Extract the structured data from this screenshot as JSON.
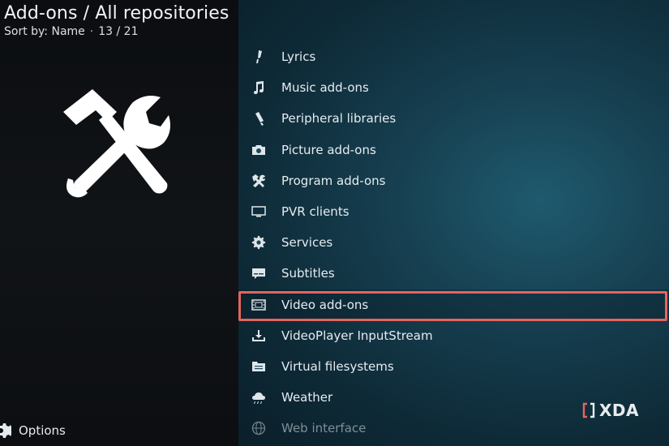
{
  "header": {
    "title": "Add-ons / All repositories",
    "sort_label": "Sort by: Name",
    "separator": "·",
    "position": "13 / 21"
  },
  "footer": {
    "options_label": "Options"
  },
  "categories": [
    {
      "label": "Lyrics",
      "icon": "microphone-icon"
    },
    {
      "label": "Music add-ons",
      "icon": "music-note-icon"
    },
    {
      "label": "Peripheral libraries",
      "icon": "usb-icon"
    },
    {
      "label": "Picture add-ons",
      "icon": "camera-icon"
    },
    {
      "label": "Program add-ons",
      "icon": "tools-icon"
    },
    {
      "label": "PVR clients",
      "icon": "tv-icon"
    },
    {
      "label": "Services",
      "icon": "gear-icon"
    },
    {
      "label": "Subtitles",
      "icon": "subtitles-icon"
    },
    {
      "label": "Video add-ons",
      "icon": "film-icon",
      "focused": true
    },
    {
      "label": "VideoPlayer InputStream",
      "icon": "download-tray-icon"
    },
    {
      "label": "Virtual filesystems",
      "icon": "folder-icon"
    },
    {
      "label": "Weather",
      "icon": "weather-icon"
    },
    {
      "label": "Web interface",
      "icon": "globe-icon",
      "dimmed": true
    }
  ],
  "watermark": {
    "text": "XDA"
  },
  "colors": {
    "focus_border": "#e5645e",
    "accent_bracket": "#e5645e"
  }
}
